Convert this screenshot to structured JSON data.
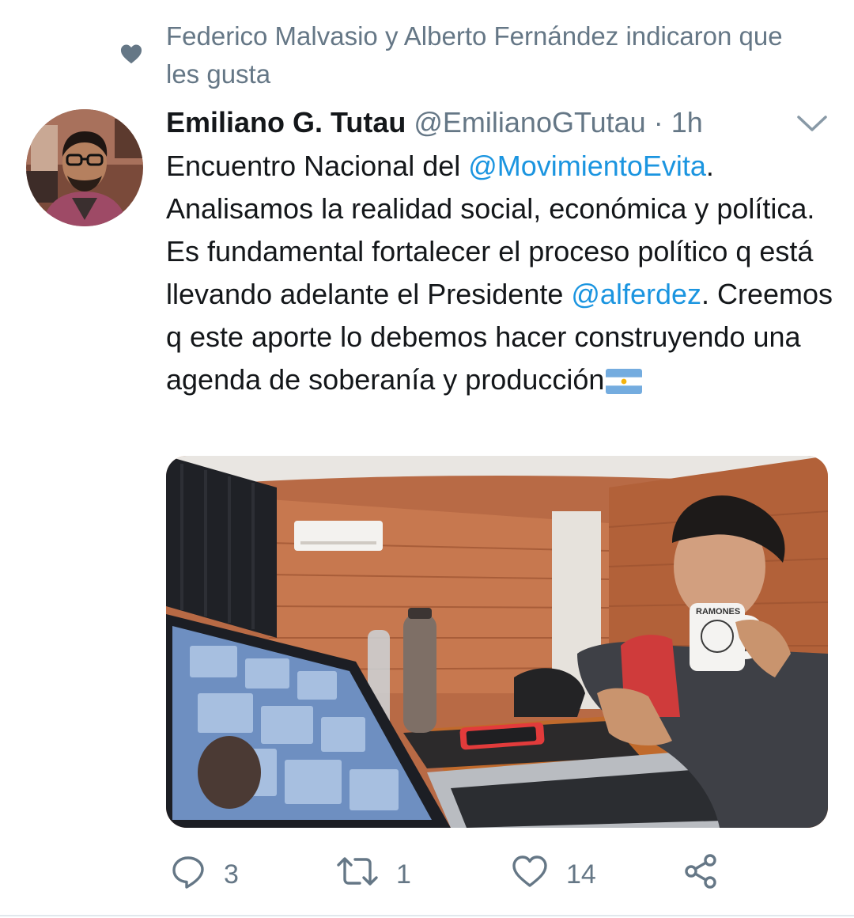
{
  "social_context": {
    "icon": "heart-icon",
    "text": "Federico Malvasio y Alberto Fernández indicaron que les gusta"
  },
  "author": {
    "name": "Emiliano G. Tutau",
    "handle": "@EmilianoGTutau",
    "separator": "·",
    "time": "1h"
  },
  "tweet": {
    "parts": [
      "Encuentro Nacional del ",
      "@MovimientoEvita",
      ". Analisamos la realidad social, económica y política. Es fundamental fortalecer el proceso político q está llevando adelante el Presidente ",
      "@alferdez",
      ". Creemos q este aporte lo debemos hacer construyendo una agenda de soberanía y producción"
    ],
    "emoji": "argentina-flag"
  },
  "media": {
    "mug_text": "RAMONES"
  },
  "actions": {
    "reply_count": "3",
    "retweet_count": "1",
    "like_count": "14"
  },
  "colors": {
    "link": "#1b95e0",
    "secondary": "#657786",
    "primary_text": "#14171a"
  }
}
